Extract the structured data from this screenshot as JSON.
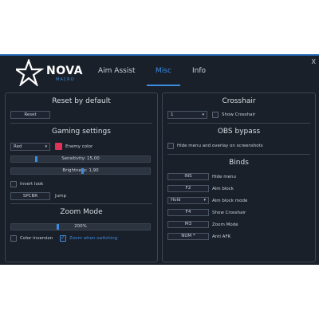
{
  "app": {
    "logo_text": "NOVA",
    "logo_sub": "MACRO",
    "close_label": "X"
  },
  "tabs": [
    {
      "label": "Aim Assist",
      "active": false
    },
    {
      "label": "Misc",
      "active": true
    },
    {
      "label": "Info",
      "active": false
    }
  ],
  "left": {
    "reset_title": "Reset by default",
    "reset_button": "Reset",
    "gaming_title": "Gaming settings",
    "enemy_color_value": "Red",
    "enemy_color_label": "Enemy color",
    "enemy_color_hex": "#e0335a",
    "sensitivity_label": "Sensitivity: 15,00",
    "sensitivity_level": 0.18,
    "brightness_label": "Brightness: 1,90",
    "brightness_level": 0.5,
    "invert_look_label": "Invert look",
    "invert_look_checked": false,
    "jump_key": "SPCBR",
    "jump_label": "Jump",
    "zoom_title": "Zoom Mode",
    "zoom_label": "200%",
    "zoom_level": 0.33,
    "color_inversion_label": "Color inversion",
    "color_inversion_checked": false,
    "zoom_when_switching_label": "Zoom when switching",
    "zoom_when_switching_checked": true
  },
  "right": {
    "crosshair_title": "Crosshair",
    "crosshair_value": "1",
    "show_crosshair_label": "Show Crosshair",
    "show_crosshair_checked": false,
    "obs_title": "OBS bypass",
    "hide_menu_label": "Hide menu and overlay on screenshots",
    "hide_menu_checked": false,
    "binds_title": "Binds",
    "binds": [
      {
        "key": "INS",
        "label": "Hide menu"
      },
      {
        "key": "F2",
        "label": "Aim block"
      },
      {
        "key": "Hold",
        "label": "Aim block mode",
        "dropdown": true
      },
      {
        "key": "F4",
        "label": "Show Crosshair"
      },
      {
        "key": "M3",
        "label": "Zoom Mode"
      },
      {
        "key": "NUM *",
        "label": "Anti AFK"
      }
    ]
  },
  "colors": {
    "accent": "#3b8be0",
    "background": "#1a2029",
    "border": "#3a4452"
  }
}
